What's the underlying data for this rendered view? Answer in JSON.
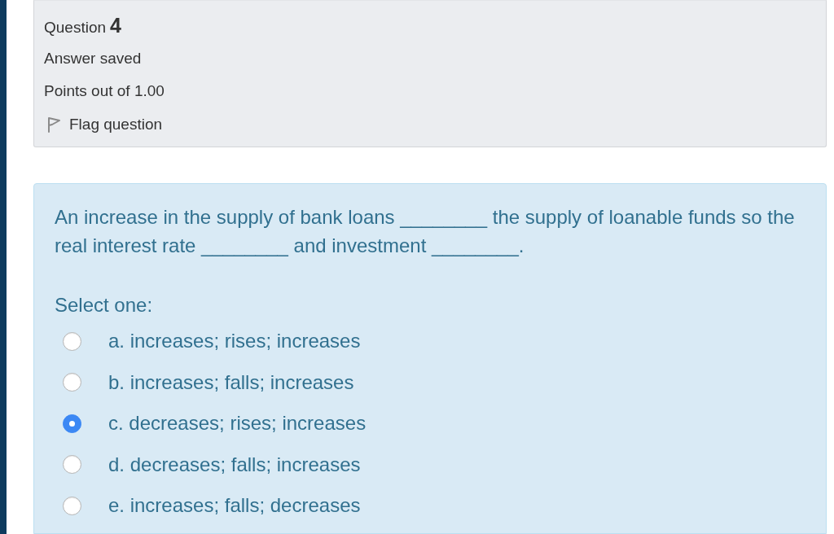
{
  "info": {
    "heading": "Question",
    "number": "4",
    "state": "Answer saved",
    "grade": "Points out of 1.00",
    "flag_link": "Flag question"
  },
  "question": {
    "text": "An increase in the supply of bank loans ________ the supply of loanable funds so the real interest rate ________ and investment ________.",
    "prompt": "Select one:",
    "options": [
      {
        "label": "a. increases; rises; increases",
        "selected": false
      },
      {
        "label": "b. increases; falls; increases",
        "selected": false
      },
      {
        "label": "c. decreases; rises; increases",
        "selected": true
      },
      {
        "label": "d. decreases; falls; increases",
        "selected": false
      },
      {
        "label": "e. increases; falls; decreases",
        "selected": false
      }
    ]
  }
}
